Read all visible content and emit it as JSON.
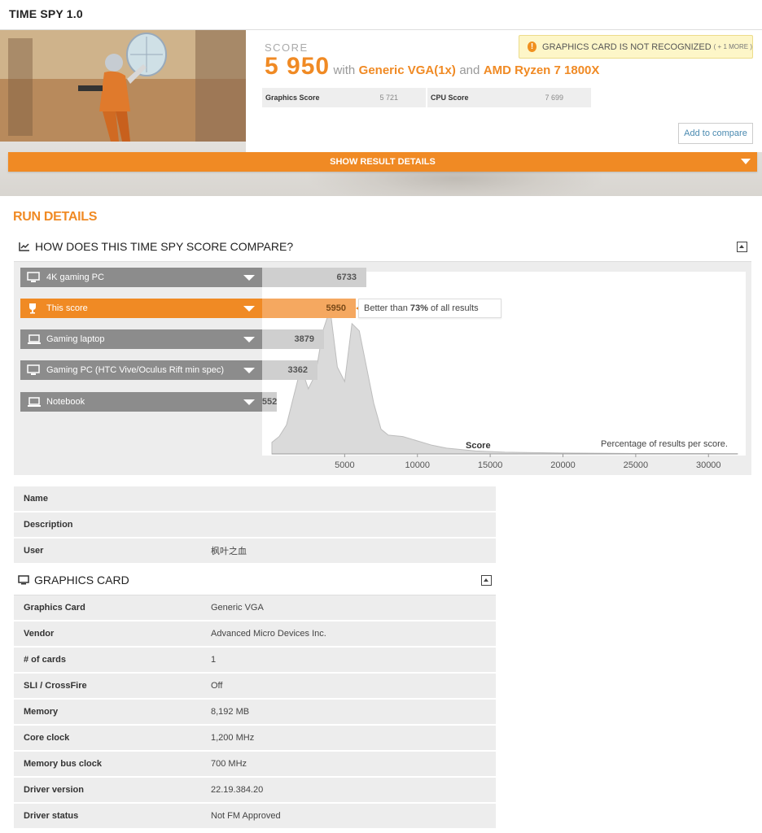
{
  "header": {
    "title": "TIME SPY 1.0"
  },
  "score": {
    "label": "SCORE",
    "value": "5 950",
    "with": "with",
    "gpu": "Generic VGA(1x)",
    "and": "and",
    "cpu": "AMD Ryzen 7 1800X",
    "warning_icon": "!",
    "warning": "GRAPHICS CARD IS NOT RECOGNIZED",
    "warning_more": "( + 1 MORE )",
    "graphics_label": "Graphics Score",
    "graphics_value": "5 721",
    "cpu_label": "CPU Score",
    "cpu_value": "7 699",
    "compare_button": "Add to compare",
    "details_button": "SHOW RESULT DETAILS"
  },
  "run_details": {
    "title": "RUN DETAILS"
  },
  "compare": {
    "title": "HOW DOES THIS TIME SPY SCORE COMPARE?",
    "bars": [
      {
        "label": "4K gaming PC",
        "value": "6733",
        "icon": "desktop-icon"
      },
      {
        "label": "This score",
        "value": "5950",
        "icon": "trophy-icon"
      },
      {
        "label": "Gaming laptop",
        "value": "3879",
        "icon": "laptop-icon"
      },
      {
        "label": "Gaming PC (HTC Vive/Oculus Rift min spec)",
        "value": "3362",
        "icon": "desktop-icon"
      },
      {
        "label": "Notebook",
        "value": "552",
        "icon": "laptop-icon"
      }
    ],
    "better_prefix": "Better than",
    "better_pct": "73%",
    "better_suffix": "of all results",
    "score_axis": "Score",
    "pct_label": "Percentage of results per score.",
    "ticks": [
      "5000",
      "10000",
      "15000",
      "20000",
      "25000",
      "30000"
    ]
  },
  "chart_data": {
    "type": "area",
    "title": "",
    "xlabel": "Score",
    "ylabel": "Percentage of results per score.",
    "xlim": [
      0,
      32000
    ],
    "x": [
      0,
      500,
      1000,
      1500,
      2000,
      2500,
      3000,
      3500,
      4000,
      4500,
      5000,
      5500,
      6000,
      6500,
      7000,
      7500,
      8000,
      9000,
      10000,
      11000,
      12000,
      14000,
      16000,
      20000,
      25000,
      30000,
      32000
    ],
    "y": [
      0.08,
      0.12,
      0.2,
      0.4,
      0.6,
      0.45,
      0.55,
      0.85,
      1.0,
      0.6,
      0.5,
      0.9,
      0.85,
      0.6,
      0.35,
      0.17,
      0.13,
      0.12,
      0.09,
      0.06,
      0.04,
      0.02,
      0.012,
      0.006,
      0.003,
      0.002,
      0.001
    ]
  },
  "info": {
    "rows": [
      {
        "k": "Name",
        "v": ""
      },
      {
        "k": "Description",
        "v": ""
      },
      {
        "k": "User",
        "v": "枫叶之血"
      }
    ]
  },
  "graphics_card": {
    "title": "GRAPHICS CARD",
    "rows": [
      {
        "k": "Graphics Card",
        "v": "Generic VGA"
      },
      {
        "k": "Vendor",
        "v": "Advanced Micro Devices Inc."
      },
      {
        "k": "# of cards",
        "v": "1"
      },
      {
        "k": "SLI / CrossFire",
        "v": "Off"
      },
      {
        "k": "Memory",
        "v": "8,192 MB"
      },
      {
        "k": "Core clock",
        "v": "1,200 MHz"
      },
      {
        "k": "Memory bus clock",
        "v": "700 MHz"
      },
      {
        "k": "Driver version",
        "v": "22.19.384.20"
      },
      {
        "k": "Driver status",
        "v": "Not FM Approved"
      }
    ]
  },
  "colors": {
    "accent": "#f08a24",
    "bar_gray": "#8c8c8c",
    "row_bg": "#ededed"
  }
}
